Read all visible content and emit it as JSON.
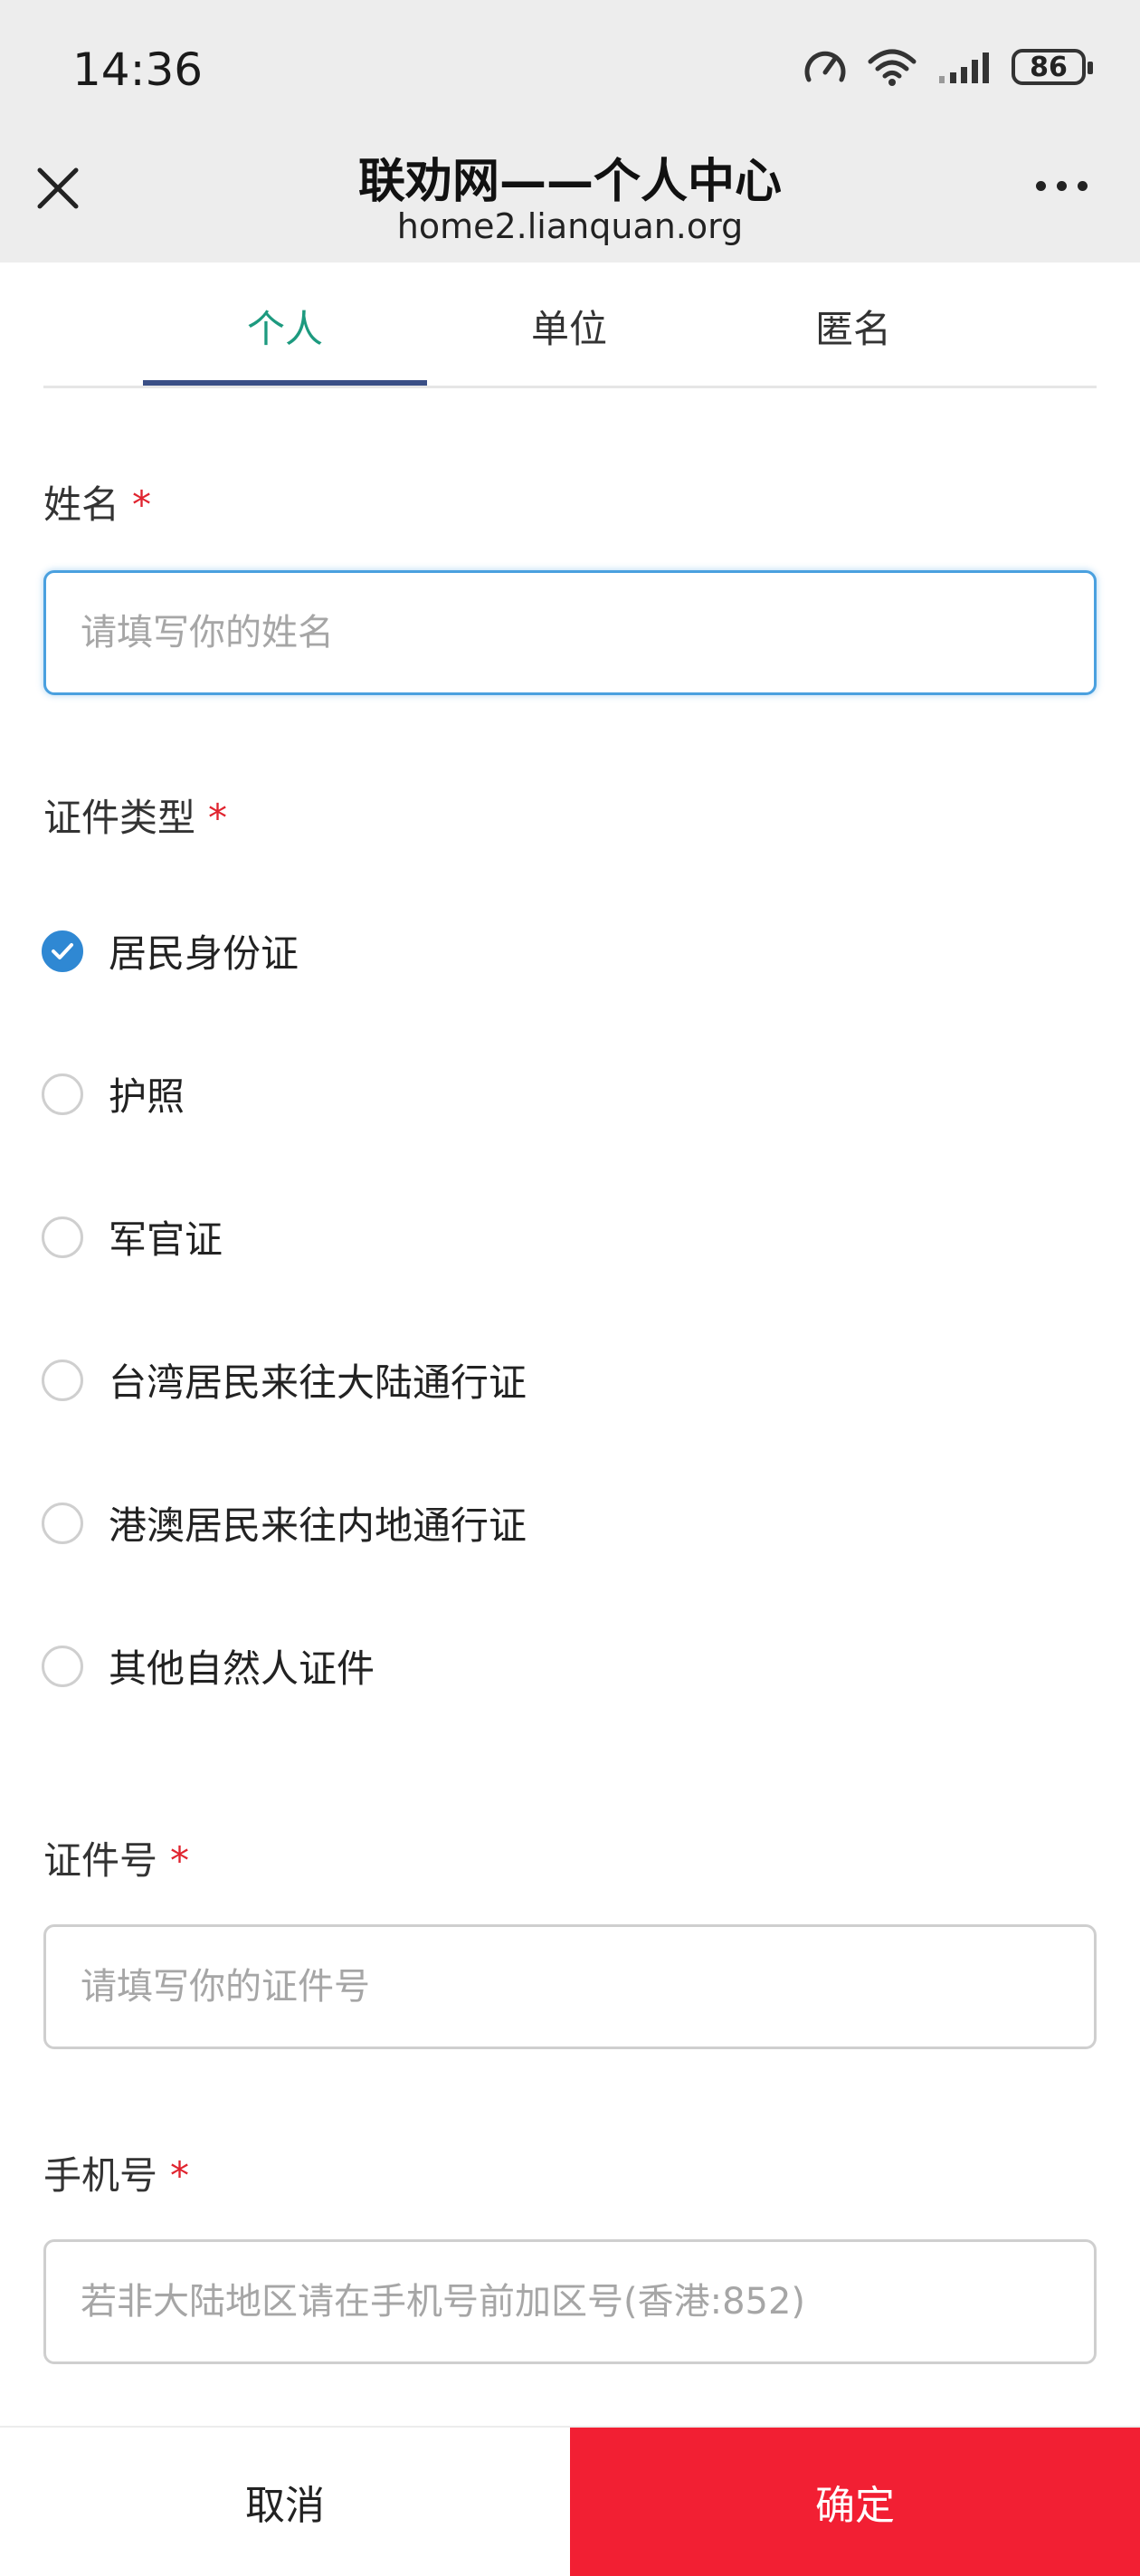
{
  "status_bar": {
    "time": "14:36",
    "battery": "86"
  },
  "header": {
    "title": "联劝网——个人中心",
    "url": "home2.lianquan.org"
  },
  "tabs": [
    {
      "label": "个人",
      "active": true
    },
    {
      "label": "单位",
      "active": false
    },
    {
      "label": "匿名",
      "active": false
    }
  ],
  "form": {
    "required_mark": "*",
    "name": {
      "label": "姓名",
      "placeholder": "请填写你的姓名",
      "value": ""
    },
    "id_type": {
      "label": "证件类型",
      "options": [
        {
          "label": "居民身份证",
          "checked": true
        },
        {
          "label": "护照",
          "checked": false
        },
        {
          "label": "军官证",
          "checked": false
        },
        {
          "label": "台湾居民来往大陆通行证",
          "checked": false
        },
        {
          "label": "港澳居民来往内地通行证",
          "checked": false
        },
        {
          "label": "其他自然人证件",
          "checked": false
        }
      ]
    },
    "id_number": {
      "label": "证件号",
      "placeholder": "请填写你的证件号",
      "value": ""
    },
    "phone": {
      "label": "手机号",
      "placeholder": "若非大陆地区请在手机号前加区号(香港:852)",
      "value": ""
    }
  },
  "actions": {
    "cancel": "取消",
    "confirm": "确定"
  },
  "colors": {
    "accent_tab": "#1d9a7f",
    "tab_underline": "#3a4f86",
    "confirm_bg": "#f21f33",
    "radio_checked": "#2f88d3",
    "required": "#e0242f"
  }
}
